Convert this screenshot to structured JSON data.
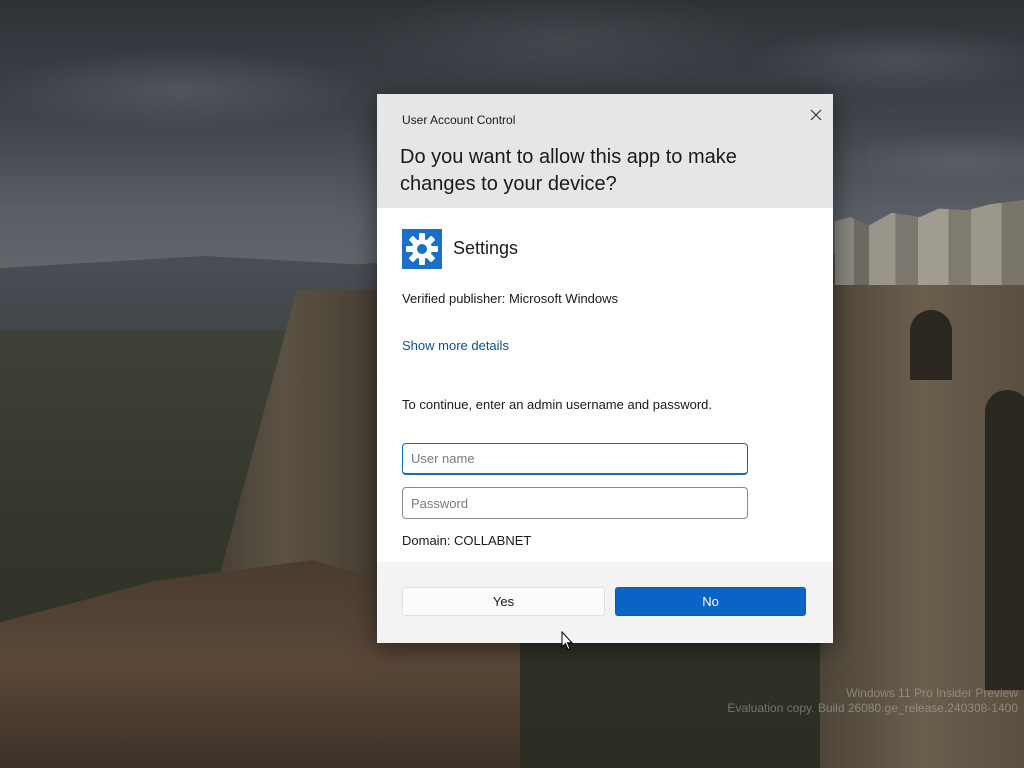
{
  "dialog": {
    "title": "User Account Control",
    "question": "Do you want to allow this app to make changes to your device?",
    "app_icon": "gear-icon",
    "app_name": "Settings",
    "publisher": "Verified publisher: Microsoft Windows",
    "details_link": "Show more details",
    "instruction": "To continue, enter an admin username and password.",
    "username_placeholder": "User name",
    "password_placeholder": "Password",
    "domain": "Domain: COLLABNET",
    "yes_label": "Yes",
    "no_label": "No",
    "colors": {
      "accent": "#0a63c5",
      "icon_bg": "#1a6fc9",
      "link": "#0e4f8f"
    }
  },
  "watermark": {
    "line1": "Windows 11 Pro Insider Preview",
    "line2": "Evaluation copy. Build 26080.ge_release.240308-1400"
  }
}
